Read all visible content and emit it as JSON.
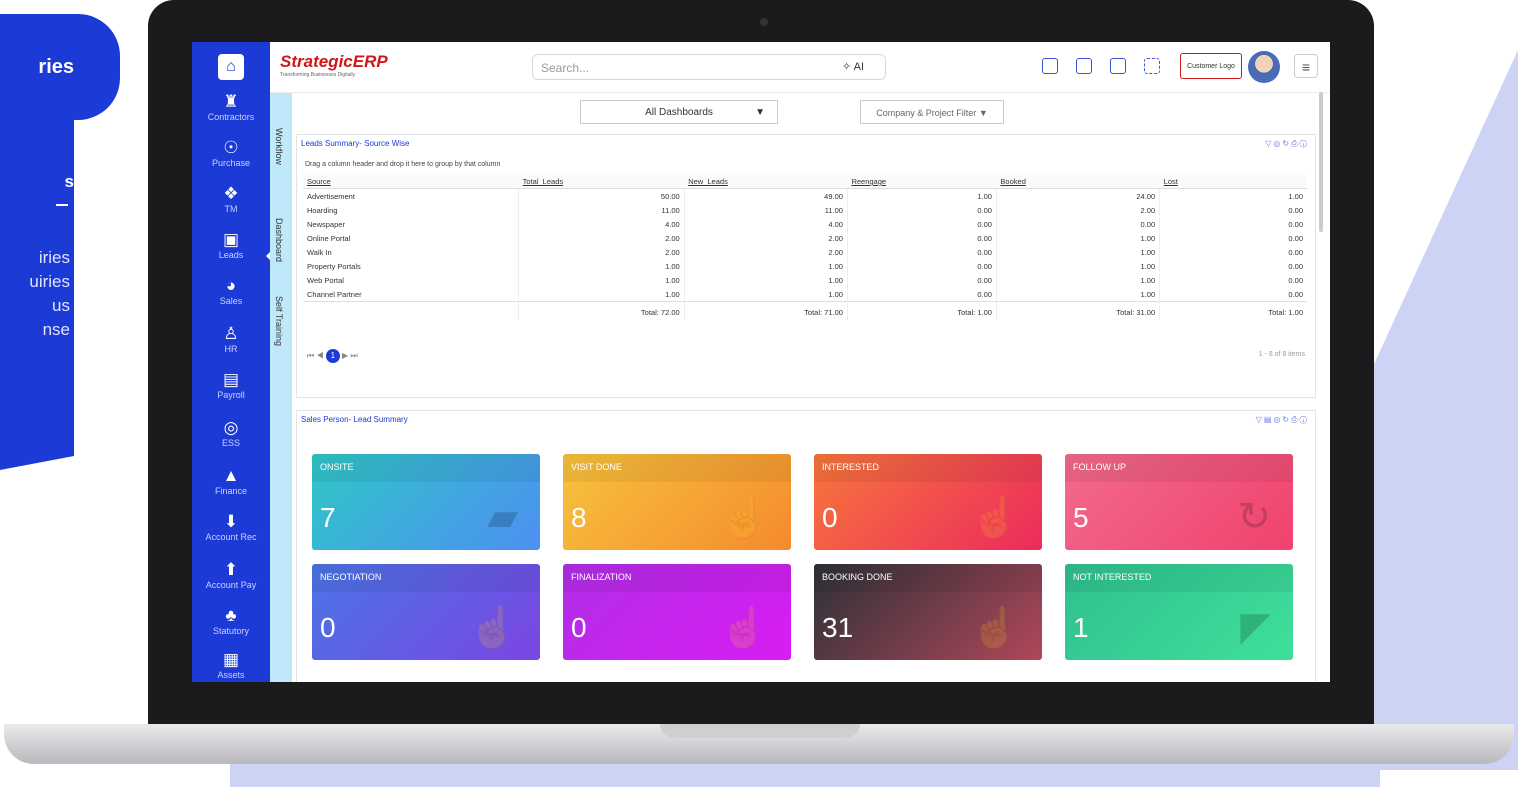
{
  "left_panel": {
    "pill_label": "ries",
    "heading": "s",
    "items": [
      "iries",
      "uiries",
      "us",
      "nse"
    ]
  },
  "sidebar": {
    "items": [
      {
        "label": "Contractors",
        "icon": "worker-icon"
      },
      {
        "label": "Purchase",
        "icon": "purchase-icon"
      },
      {
        "label": "TM",
        "icon": "tm-icon"
      },
      {
        "label": "Leads",
        "icon": "leads-icon"
      },
      {
        "label": "Sales",
        "icon": "sales-icon"
      },
      {
        "label": "HR",
        "icon": "hr-icon"
      },
      {
        "label": "Payroll",
        "icon": "payroll-icon"
      },
      {
        "label": "ESS",
        "icon": "ess-icon"
      },
      {
        "label": "Finance",
        "icon": "finance-icon"
      },
      {
        "label": "Account Rec",
        "icon": "account-rec-icon"
      },
      {
        "label": "Account Pay",
        "icon": "account-pay-icon"
      },
      {
        "label": "Statutory",
        "icon": "statutory-icon"
      },
      {
        "label": "Assets",
        "icon": "assets-icon"
      }
    ],
    "vertical_tabs": [
      "Workflow",
      "Dashboard",
      "Self Training"
    ]
  },
  "header": {
    "logo": "StrategicERP",
    "logo_sub": "Transforming Businesses Digitally",
    "search_placeholder": "Search...",
    "ai_label": "AI",
    "customer_logo": "Customer Logo"
  },
  "filters": {
    "dashboard": "All Dashboards",
    "company_filter": "Company & Project Filter"
  },
  "leads_summary": {
    "title": "Leads Summary- Source Wise",
    "group_hint": "Drag a column header and drop it here to group by that column",
    "columns": [
      "Source",
      "Total_Leads",
      "New_Leads",
      "Reengage",
      "Booked",
      "Lost"
    ],
    "rows": [
      [
        "Advertisement",
        "50.00",
        "49.00",
        "1.00",
        "24.00",
        "1.00"
      ],
      [
        "Hoarding",
        "11.00",
        "11.00",
        "0.00",
        "2.00",
        "0.00"
      ],
      [
        "Newspaper",
        "4.00",
        "4.00",
        "0.00",
        "0.00",
        "0.00"
      ],
      [
        "Online Portal",
        "2.00",
        "2.00",
        "0.00",
        "1.00",
        "0.00"
      ],
      [
        "Walk In",
        "2.00",
        "2.00",
        "0.00",
        "1.00",
        "0.00"
      ],
      [
        "Property Portals",
        "1.00",
        "1.00",
        "0.00",
        "1.00",
        "0.00"
      ],
      [
        "Web Portal",
        "1.00",
        "1.00",
        "0.00",
        "1.00",
        "0.00"
      ],
      [
        "Channel Partner",
        "1.00",
        "1.00",
        "0.00",
        "1.00",
        "0.00"
      ]
    ],
    "totals": [
      "",
      "Total: 72.00",
      "Total: 71.00",
      "Total: 1.00",
      "Total: 31.00",
      "Total: 1.00"
    ],
    "page": "1",
    "items_info": "1 - 8 of 8 items"
  },
  "sales_summary": {
    "title": "Sales Person- Lead Summary",
    "cards": [
      {
        "label": "ONSITE",
        "value": "7",
        "icon": "briefcase-icon",
        "gradient": [
          "#2fc7c7",
          "#4d8ff2"
        ]
      },
      {
        "label": "VISIT DONE",
        "value": "8",
        "icon": "thumbs-up-icon",
        "gradient": [
          "#f7c33d",
          "#f58a2e"
        ]
      },
      {
        "label": "INTERESTED",
        "value": "0",
        "icon": "thumbs-up-icon",
        "gradient": [
          "#f7763a",
          "#ec2a5e"
        ]
      },
      {
        "label": "FOLLOW UP",
        "value": "5",
        "icon": "refresh-icon",
        "gradient": [
          "#f26b8b",
          "#f0426d"
        ]
      },
      {
        "label": "NEGOTIATION",
        "value": "0",
        "icon": "thumbs-up-icon",
        "gradient": [
          "#4a75e6",
          "#7b45e3"
        ]
      },
      {
        "label": "FINALIZATION",
        "value": "0",
        "icon": "thumbs-up-icon",
        "gradient": [
          "#b12ee8",
          "#d91cf3"
        ]
      },
      {
        "label": "BOOKING DONE",
        "value": "31",
        "icon": "thumbs-up-icon",
        "gradient": [
          "#2d3137",
          "#b0475a"
        ]
      },
      {
        "label": "NOT INTERESTED",
        "value": "1",
        "icon": "megaphone-icon",
        "gradient": [
          "#2fc08f",
          "#3fe09a"
        ]
      }
    ]
  }
}
